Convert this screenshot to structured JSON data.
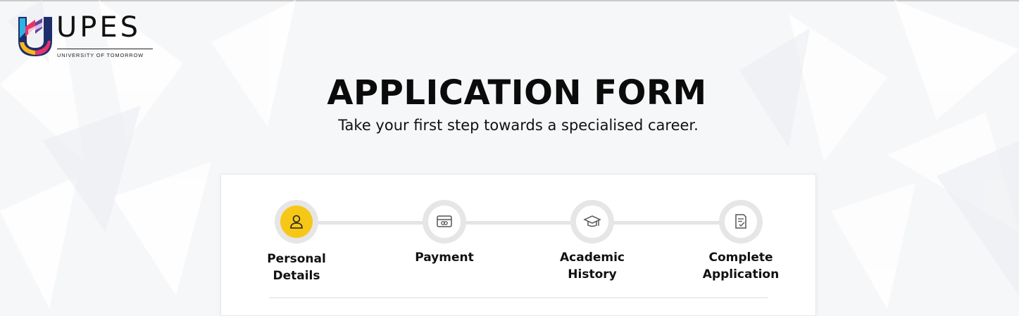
{
  "logo": {
    "wordmark": "UPES",
    "tagline": "UNIVERSITY OF TOMORROW",
    "colors": [
      "#2bb3e6",
      "#e8336b",
      "#f5b71b",
      "#6a3fa0",
      "#1f2e6b"
    ]
  },
  "header": {
    "title": "APPLICATION FORM",
    "subtitle": "Take your first step towards a specialised career."
  },
  "stepper": {
    "active_color": "#f7c718",
    "track_color": "#e4e4e4",
    "steps": [
      {
        "label": "Personal\nDetails",
        "icon": "user-icon",
        "active": true
      },
      {
        "label": "Payment",
        "icon": "payment-card-icon",
        "active": false
      },
      {
        "label": "Academic\nHistory",
        "icon": "graduation-cap-icon",
        "active": false
      },
      {
        "label": "Complete\nApplication",
        "icon": "document-check-icon",
        "active": false
      }
    ]
  }
}
